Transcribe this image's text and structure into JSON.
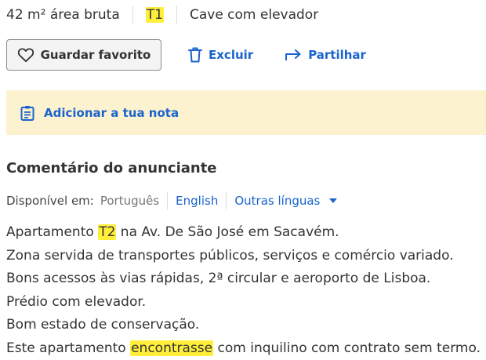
{
  "features": {
    "area": "42 m² área bruta",
    "typology": "T1",
    "floor": "Cave com elevador"
  },
  "actions": {
    "favorite_label": "Guardar favorito",
    "delete_label": "Excluir",
    "share_label": "Partilhar"
  },
  "note": {
    "add_label": "Adicionar a tua nota"
  },
  "comment": {
    "title": "Comentário do anunciante",
    "available_label": "Disponível em:",
    "current_language": "Português",
    "alt_language": "English",
    "more_languages": "Outras línguas"
  },
  "description": {
    "line1_before": "Apartamento ",
    "line1_highlight": "T2",
    "line1_after": " na Av. De São José em Sacavém.",
    "line2": "Zona servida de transportes públicos, serviços e comércio variado.",
    "line3": "Bons acessos às vias rápidas, 2ª circular e aeroporto de Lisboa.",
    "line4": "Prédio com elevador.",
    "line5": "Bom estado de conservação.",
    "line6_before": "Este apartamento ",
    "line6_highlight": "encontrasse",
    "line6_after": " com inquilino com contrato sem termo."
  },
  "colors": {
    "link": "#1a64cc",
    "highlight": "#ffef3a",
    "note_background": "#fdf2d0"
  },
  "icons": {
    "favorite": "heart-icon",
    "delete": "trash-icon",
    "share": "share-arrow-icon",
    "note": "note-icon",
    "dropdown": "caret-down-icon"
  }
}
